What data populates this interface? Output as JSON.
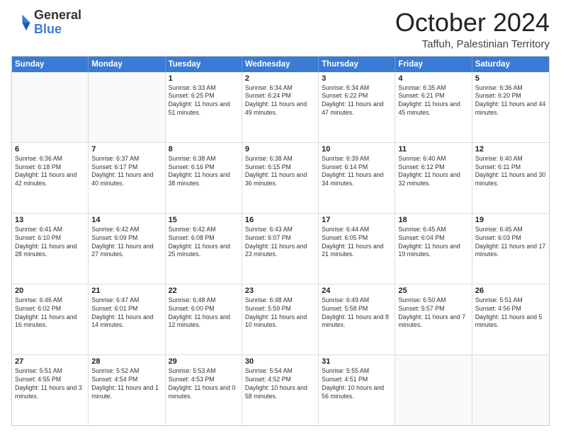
{
  "header": {
    "logo": {
      "general": "General",
      "blue": "Blue"
    },
    "month": "October 2024",
    "location": "Taffuh, Palestinian Territory"
  },
  "weekdays": [
    "Sunday",
    "Monday",
    "Tuesday",
    "Wednesday",
    "Thursday",
    "Friday",
    "Saturday"
  ],
  "rows": [
    [
      {
        "day": "",
        "info": ""
      },
      {
        "day": "",
        "info": ""
      },
      {
        "day": "1",
        "info": "Sunrise: 6:33 AM\nSunset: 6:25 PM\nDaylight: 11 hours and 51 minutes."
      },
      {
        "day": "2",
        "info": "Sunrise: 6:34 AM\nSunset: 6:24 PM\nDaylight: 11 hours and 49 minutes."
      },
      {
        "day": "3",
        "info": "Sunrise: 6:34 AM\nSunset: 6:22 PM\nDaylight: 11 hours and 47 minutes."
      },
      {
        "day": "4",
        "info": "Sunrise: 6:35 AM\nSunset: 6:21 PM\nDaylight: 11 hours and 45 minutes."
      },
      {
        "day": "5",
        "info": "Sunrise: 6:36 AM\nSunset: 6:20 PM\nDaylight: 11 hours and 44 minutes."
      }
    ],
    [
      {
        "day": "6",
        "info": "Sunrise: 6:36 AM\nSunset: 6:18 PM\nDaylight: 11 hours and 42 minutes."
      },
      {
        "day": "7",
        "info": "Sunrise: 6:37 AM\nSunset: 6:17 PM\nDaylight: 11 hours and 40 minutes."
      },
      {
        "day": "8",
        "info": "Sunrise: 6:38 AM\nSunset: 6:16 PM\nDaylight: 11 hours and 38 minutes."
      },
      {
        "day": "9",
        "info": "Sunrise: 6:38 AM\nSunset: 6:15 PM\nDaylight: 11 hours and 36 minutes."
      },
      {
        "day": "10",
        "info": "Sunrise: 6:39 AM\nSunset: 6:14 PM\nDaylight: 11 hours and 34 minutes."
      },
      {
        "day": "11",
        "info": "Sunrise: 6:40 AM\nSunset: 6:12 PM\nDaylight: 11 hours and 32 minutes."
      },
      {
        "day": "12",
        "info": "Sunrise: 6:40 AM\nSunset: 6:11 PM\nDaylight: 11 hours and 30 minutes."
      }
    ],
    [
      {
        "day": "13",
        "info": "Sunrise: 6:41 AM\nSunset: 6:10 PM\nDaylight: 11 hours and 28 minutes."
      },
      {
        "day": "14",
        "info": "Sunrise: 6:42 AM\nSunset: 6:09 PM\nDaylight: 11 hours and 27 minutes."
      },
      {
        "day": "15",
        "info": "Sunrise: 6:42 AM\nSunset: 6:08 PM\nDaylight: 11 hours and 25 minutes."
      },
      {
        "day": "16",
        "info": "Sunrise: 6:43 AM\nSunset: 6:07 PM\nDaylight: 11 hours and 23 minutes."
      },
      {
        "day": "17",
        "info": "Sunrise: 6:44 AM\nSunset: 6:05 PM\nDaylight: 11 hours and 21 minutes."
      },
      {
        "day": "18",
        "info": "Sunrise: 6:45 AM\nSunset: 6:04 PM\nDaylight: 11 hours and 19 minutes."
      },
      {
        "day": "19",
        "info": "Sunrise: 6:45 AM\nSunset: 6:03 PM\nDaylight: 11 hours and 17 minutes."
      }
    ],
    [
      {
        "day": "20",
        "info": "Sunrise: 6:46 AM\nSunset: 6:02 PM\nDaylight: 11 hours and 16 minutes."
      },
      {
        "day": "21",
        "info": "Sunrise: 6:47 AM\nSunset: 6:01 PM\nDaylight: 11 hours and 14 minutes."
      },
      {
        "day": "22",
        "info": "Sunrise: 6:48 AM\nSunset: 6:00 PM\nDaylight: 11 hours and 12 minutes."
      },
      {
        "day": "23",
        "info": "Sunrise: 6:48 AM\nSunset: 5:59 PM\nDaylight: 11 hours and 10 minutes."
      },
      {
        "day": "24",
        "info": "Sunrise: 6:49 AM\nSunset: 5:58 PM\nDaylight: 11 hours and 8 minutes."
      },
      {
        "day": "25",
        "info": "Sunrise: 6:50 AM\nSunset: 5:57 PM\nDaylight: 11 hours and 7 minutes."
      },
      {
        "day": "26",
        "info": "Sunrise: 5:51 AM\nSunset: 4:56 PM\nDaylight: 11 hours and 5 minutes."
      }
    ],
    [
      {
        "day": "27",
        "info": "Sunrise: 5:51 AM\nSunset: 4:55 PM\nDaylight: 11 hours and 3 minutes."
      },
      {
        "day": "28",
        "info": "Sunrise: 5:52 AM\nSunset: 4:54 PM\nDaylight: 11 hours and 1 minute."
      },
      {
        "day": "29",
        "info": "Sunrise: 5:53 AM\nSunset: 4:53 PM\nDaylight: 11 hours and 0 minutes."
      },
      {
        "day": "30",
        "info": "Sunrise: 5:54 AM\nSunset: 4:52 PM\nDaylight: 10 hours and 58 minutes."
      },
      {
        "day": "31",
        "info": "Sunrise: 5:55 AM\nSunset: 4:51 PM\nDaylight: 10 hours and 56 minutes."
      },
      {
        "day": "",
        "info": ""
      },
      {
        "day": "",
        "info": ""
      }
    ]
  ]
}
